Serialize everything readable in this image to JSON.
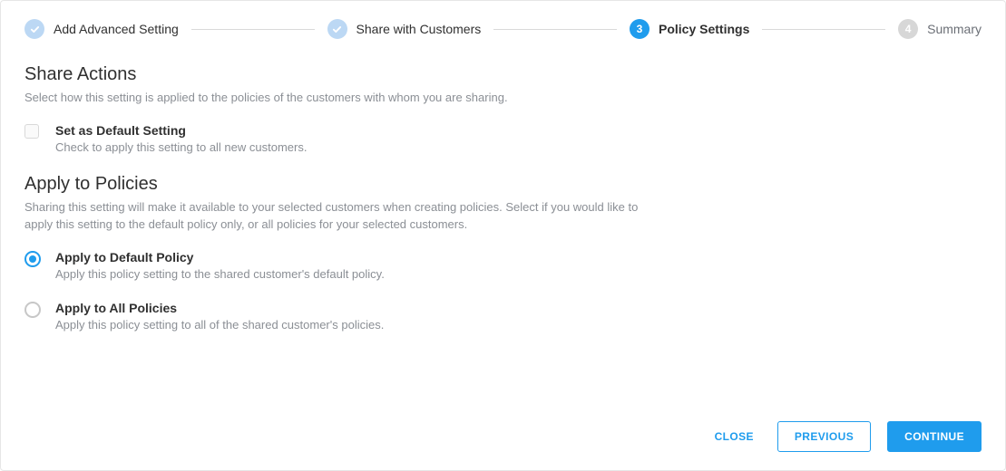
{
  "stepper": {
    "steps": [
      {
        "label": "Add Advanced Setting",
        "state": "done"
      },
      {
        "label": "Share with Customers",
        "state": "done"
      },
      {
        "label": "Policy Settings",
        "state": "active",
        "number": "3"
      },
      {
        "label": "Summary",
        "state": "upcoming",
        "number": "4"
      }
    ]
  },
  "shareActions": {
    "title": "Share Actions",
    "desc": "Select how this setting is applied to the policies of the customers with whom you are sharing.",
    "default": {
      "title": "Set as Default Setting",
      "sub": "Check to apply this setting to all new customers."
    }
  },
  "applyPolicies": {
    "title": "Apply to Policies",
    "desc": "Sharing this setting will make it available to your selected customers when creating policies. Select if you would like to apply this setting to the default policy only, or all policies for your selected customers.",
    "optDefault": {
      "title": "Apply to Default Policy",
      "sub": "Apply this policy setting to the shared customer's default policy."
    },
    "optAll": {
      "title": "Apply to All Policies",
      "sub": "Apply this policy setting to all of the shared customer's policies."
    }
  },
  "footer": {
    "close": "CLOSE",
    "previous": "PREVIOUS",
    "continue": "CONTINUE"
  }
}
